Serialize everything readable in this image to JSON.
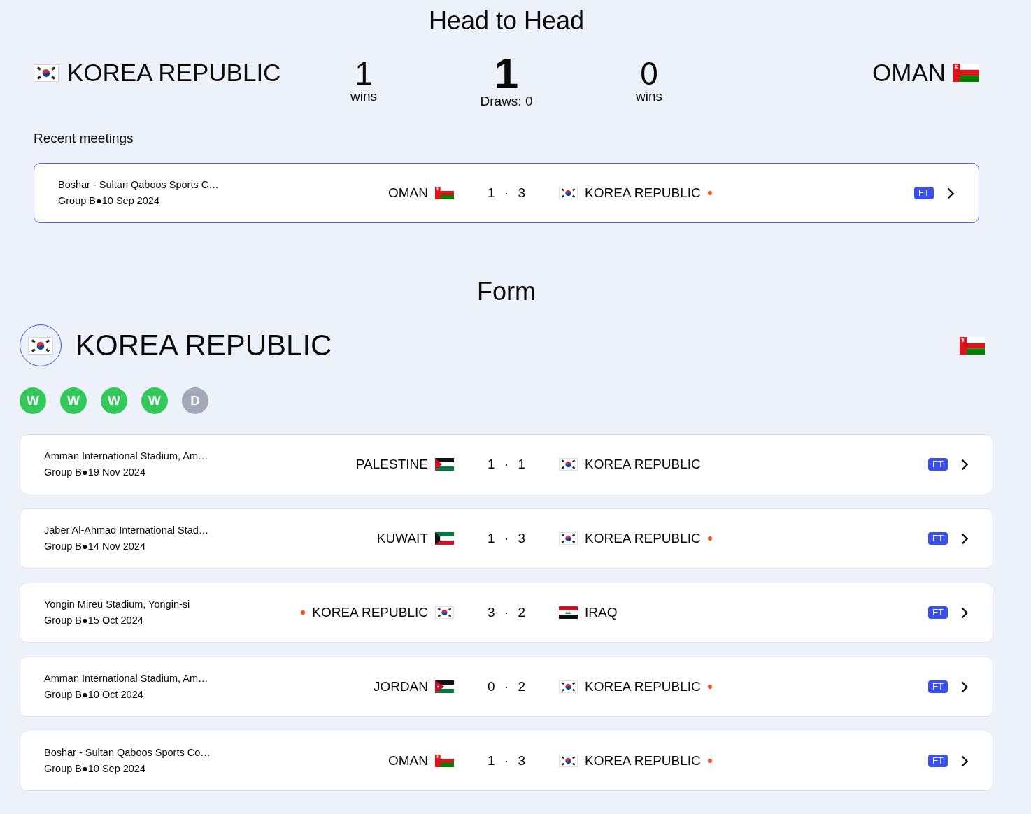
{
  "head_to_head": {
    "title": "Head to Head",
    "home_team": {
      "name": "KOREA REPUBLIC",
      "kind": "korea"
    },
    "home_wins": {
      "value": "1",
      "label": "wins"
    },
    "total": {
      "value": "1",
      "label": "Draws: 0"
    },
    "away_wins": {
      "value": "0",
      "label": "wins"
    },
    "away_team": {
      "name": "OMAN",
      "kind": "oman"
    }
  },
  "recent_meetings": {
    "title": "Recent meetings",
    "matches": [
      {
        "venue": "Boshar - Sultan Qaboos Sports C…",
        "info": "Group B●10 Sep 2024",
        "home": {
          "name": "OMAN",
          "kind": "oman",
          "winner": false
        },
        "score": "1 · 3",
        "away": {
          "name": "KOREA REPUBLIC",
          "kind": "korea",
          "winner": true
        },
        "status": "FT",
        "highlighted": true
      }
    ]
  },
  "form": {
    "title": "Form",
    "team_name": "KOREA REPUBLIC",
    "team_switch": [
      {
        "kind": "korea",
        "selected": true
      },
      {
        "kind": "oman",
        "selected": false
      }
    ],
    "results": [
      {
        "label": "W",
        "color": "#32c85a"
      },
      {
        "label": "W",
        "color": "#32c85a"
      },
      {
        "label": "W",
        "color": "#32c85a"
      },
      {
        "label": "W",
        "color": "#32c85a"
      },
      {
        "label": "D",
        "color": "#a3a9b8"
      }
    ],
    "matches": [
      {
        "venue": "Amman International Stadium, Am…",
        "info": "Group B●19 Nov 2024",
        "home": {
          "name": "PALESTINE",
          "kind": "palestine",
          "winner": false
        },
        "score": "1 · 1",
        "away": {
          "name": "KOREA REPUBLIC",
          "kind": "korea",
          "winner": false
        },
        "status": "FT",
        "highlighted": false
      },
      {
        "venue": "Jaber Al-Ahmad International Stad…",
        "info": "Group B●14 Nov 2024",
        "home": {
          "name": "KUWAIT",
          "kind": "kuwait",
          "winner": false
        },
        "score": "1 · 3",
        "away": {
          "name": "KOREA REPUBLIC",
          "kind": "korea",
          "winner": true
        },
        "status": "FT",
        "highlighted": false
      },
      {
        "venue": "Yongin Mireu Stadium, Yongin-si",
        "info": "Group B●15 Oct 2024",
        "home": {
          "name": "KOREA REPUBLIC",
          "kind": "korea",
          "winner": true
        },
        "score": "3 · 2",
        "away": {
          "name": "IRAQ",
          "kind": "iraq",
          "winner": false
        },
        "status": "FT",
        "highlighted": false
      },
      {
        "venue": "Amman International Stadium, Am…",
        "info": "Group B●10 Oct 2024",
        "home": {
          "name": "JORDAN",
          "kind": "jordan",
          "winner": false
        },
        "score": "0 · 2",
        "away": {
          "name": "KOREA REPUBLIC",
          "kind": "korea",
          "winner": true
        },
        "status": "FT",
        "highlighted": false
      },
      {
        "venue": "Boshar - Sultan Qaboos Sports Co…",
        "info": "Group B●10 Sep 2024",
        "home": {
          "name": "OMAN",
          "kind": "oman",
          "winner": false
        },
        "score": "1 · 3",
        "away": {
          "name": "KOREA REPUBLIC",
          "kind": "korea",
          "winner": true
        },
        "status": "FT",
        "highlighted": false
      }
    ]
  }
}
